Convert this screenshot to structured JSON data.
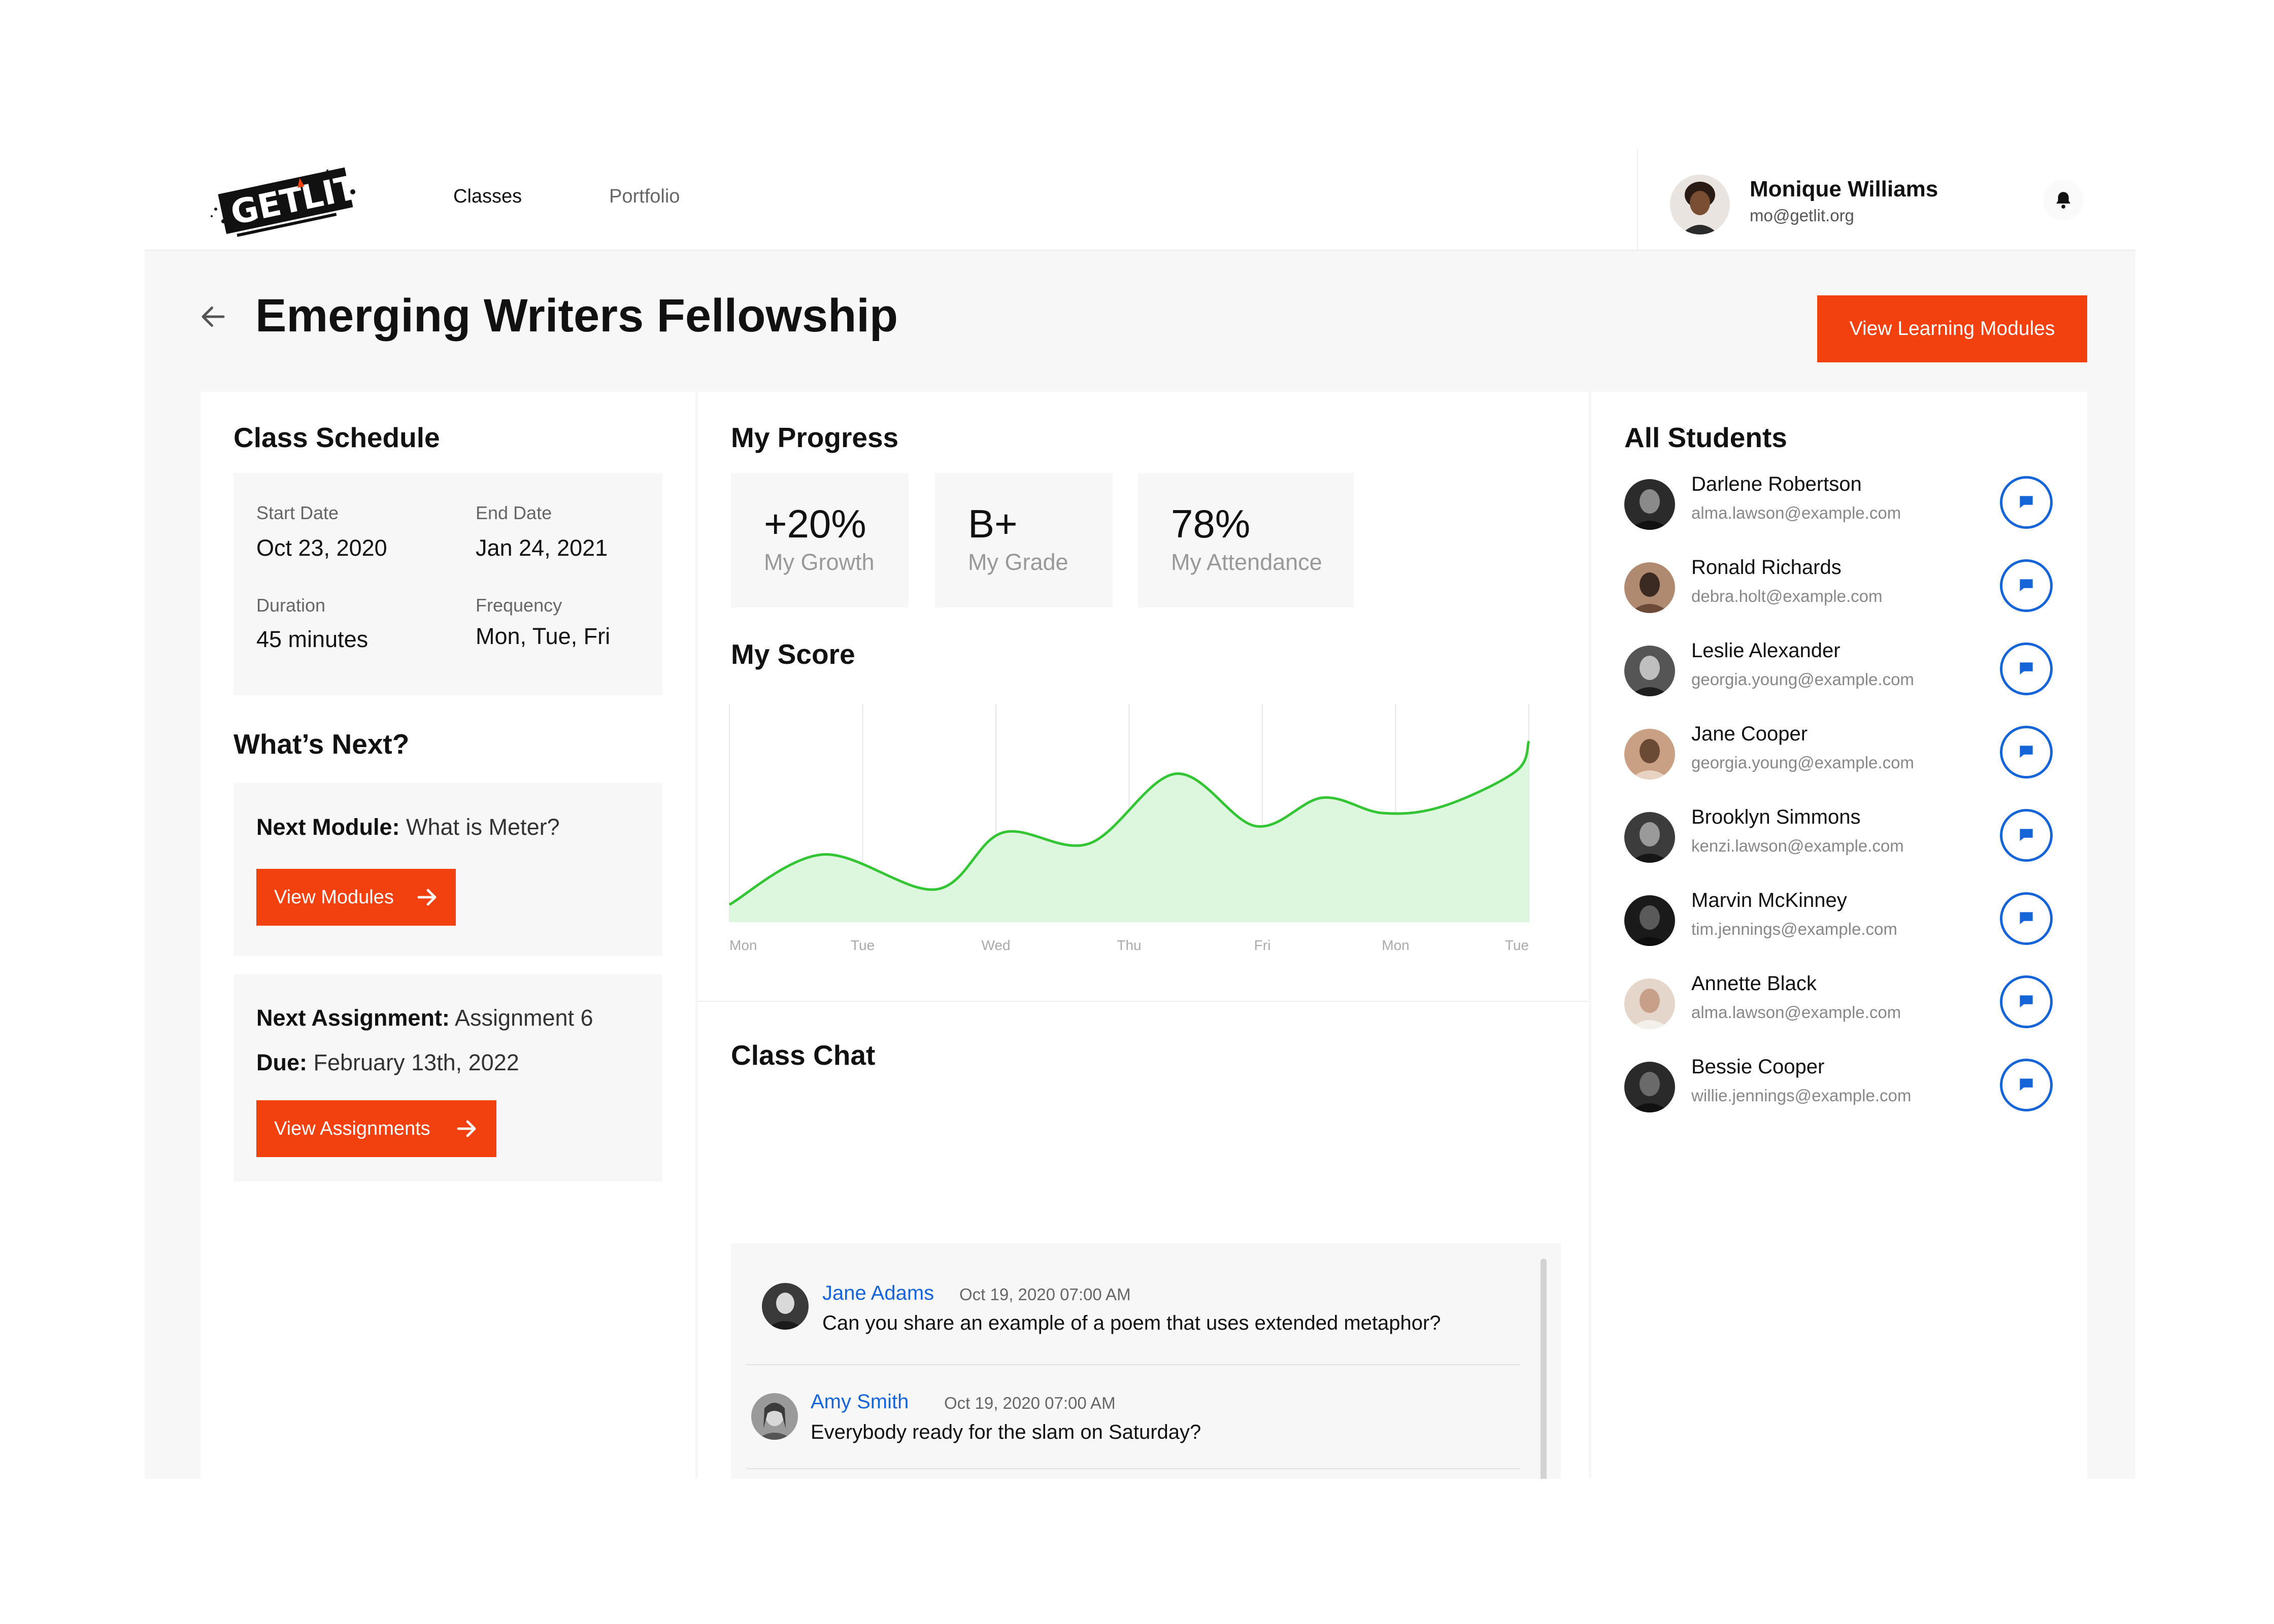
{
  "header": {
    "logo_text": "GET LIT",
    "nav": [
      {
        "label": "Classes",
        "active": true
      },
      {
        "label": "Portfolio",
        "active": false
      }
    ],
    "user": {
      "name": "Monique Williams",
      "email": "mo@getlit.org"
    },
    "icons": {
      "notifications": "bell-icon"
    }
  },
  "page": {
    "title": "Emerging Writers Fellowship",
    "primary_action": "View Learning Modules",
    "accent_color": "#f2410f",
    "link_color": "#1565d8"
  },
  "schedule": {
    "title": "Class Schedule",
    "start_label": "Start Date",
    "start_value": "Oct 23, 2020",
    "end_label": "End Date",
    "end_value": "Jan 24, 2021",
    "duration_label": "Duration",
    "duration_value": "45 minutes",
    "frequency_label": "Frequency",
    "frequency_value": "Mon, Tue, Fri"
  },
  "whats_next": {
    "title": "What’s Next?",
    "module_label": "Next Module:",
    "module_value": " What is Meter?",
    "module_button": "View Modules",
    "assignment_label": "Next Assignment:",
    "assignment_value": " Assignment 6",
    "due_label": "Due:",
    "due_value": " February 13th, 2022",
    "assignment_button": "View Assignments"
  },
  "progress": {
    "title": "My Progress",
    "stats": [
      {
        "value": "+20%",
        "label": "My Growth"
      },
      {
        "value": "B+",
        "label": "My Grade"
      },
      {
        "value": "78%",
        "label": "My Attendance"
      }
    ]
  },
  "score": {
    "title": "My Score"
  },
  "chart_data": {
    "type": "area",
    "categories": [
      "Mon",
      "Tue",
      "Wed",
      "Thu",
      "Fri",
      "Mon",
      "Tue"
    ],
    "x": [
      0,
      0.7,
      1.55,
      2.05,
      2.7,
      3.35,
      3.95,
      4.45,
      4.9,
      5.35,
      5.9,
      6.0
    ],
    "values": [
      8,
      31,
      15,
      41,
      36,
      68,
      44,
      57,
      50,
      53,
      69,
      83
    ],
    "ylim": [
      0,
      100
    ],
    "line_color": "#34c534",
    "fill_color": "#ddf7df",
    "grid": "vertical",
    "series": [
      {
        "values": [
          8,
          31,
          15,
          41,
          36,
          68,
          44,
          57,
          50,
          53,
          69,
          83
        ]
      }
    ]
  },
  "chat": {
    "title": "Class Chat",
    "messages": [
      {
        "name": "Jane Adams",
        "time": "Oct 19, 2020 07:00 AM",
        "text": "Can you share an example of a poem that uses extended metaphor?"
      },
      {
        "name": "Amy Smith",
        "time": "Oct 19, 2020 07:00 AM",
        "text": "Everybody ready for the slam on Saturday?"
      }
    ]
  },
  "students": {
    "title": "All Students",
    "list": [
      {
        "name": "Darlene Robertson",
        "email": "alma.lawson@example.com"
      },
      {
        "name": "Ronald Richards",
        "email": "debra.holt@example.com"
      },
      {
        "name": "Leslie Alexander",
        "email": "georgia.young@example.com"
      },
      {
        "name": "Jane Cooper",
        "email": "georgia.young@example.com"
      },
      {
        "name": "Brooklyn Simmons",
        "email": "kenzi.lawson@example.com"
      },
      {
        "name": "Marvin McKinney",
        "email": "tim.jennings@example.com"
      },
      {
        "name": "Annette Black",
        "email": "alma.lawson@example.com"
      },
      {
        "name": "Bessie Cooper",
        "email": "willie.jennings@example.com"
      }
    ]
  }
}
